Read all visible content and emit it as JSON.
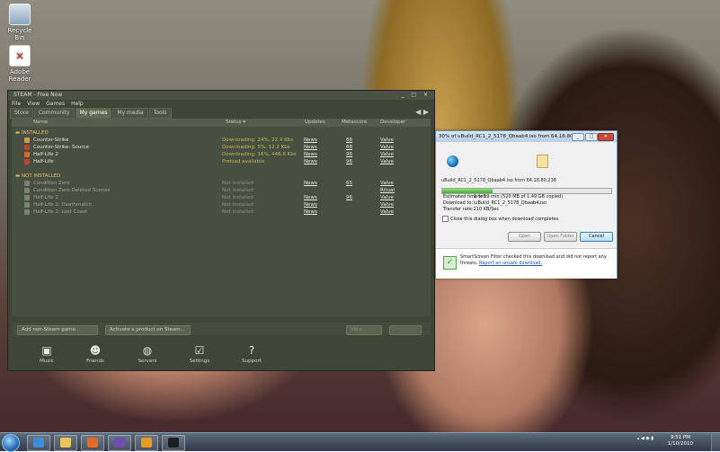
{
  "desktop": {
    "icons": [
      {
        "label": "Recycle Bin",
        "icon": "recycle-bin-icon"
      },
      {
        "label": "Adobe Reader",
        "icon": "pdf-icon"
      }
    ]
  },
  "steam": {
    "title": "STEAM - Free Now",
    "menu": [
      "File",
      "View",
      "Games",
      "Help"
    ],
    "tabs": [
      "Store",
      "Community",
      "My games",
      "My media",
      "Tools"
    ],
    "active_tab": "My games",
    "columns": [
      "Name",
      "Status ▾",
      "Updates",
      "Metascore",
      "Developer"
    ],
    "installed_heading": "▬ INSTALLED",
    "not_installed_heading": "▬ NOT INSTALLED",
    "installed": [
      {
        "name": "Counter-Strike",
        "status": "Downloading: 24%, 22.4 Kbs",
        "news": "News",
        "meta": "88",
        "dev": "Valve",
        "color": "#c9a04a"
      },
      {
        "name": "Counter-Strike: Source",
        "status": "Downloading: 5%, 12.2 Kbs",
        "news": "News",
        "meta": "88",
        "dev": "Valve",
        "color": "#b04c2c"
      },
      {
        "name": "Half-Life 2",
        "status": "Downloading: 16%, 446.6 Kbs",
        "news": "News",
        "meta": "96",
        "dev": "Valve",
        "color": "#d76b2e"
      },
      {
        "name": "Half-Life",
        "status": "Preload available",
        "news": "News",
        "meta": "96",
        "dev": "Valve",
        "color": "#c8442a"
      }
    ],
    "not_installed": [
      {
        "name": "Condition Zero",
        "status": "Not installed",
        "news": "News",
        "meta": "65",
        "dev": "Valve"
      },
      {
        "name": "Condition Zero Deleted Scenes",
        "status": "Not installed",
        "news": "",
        "meta": "",
        "dev": "Ritual"
      },
      {
        "name": "Half-Life 2",
        "status": "Not installed",
        "news": "News",
        "meta": "96",
        "dev": "Valve"
      },
      {
        "name": "Half-Life 2: Deathmatch",
        "status": "Not installed",
        "news": "News",
        "meta": "",
        "dev": "Valve"
      },
      {
        "name": "Half-Life 2: Lost Coast",
        "status": "Not installed",
        "news": "News",
        "meta": "",
        "dev": "Valve"
      }
    ],
    "add_game_button": "Add non-Steam game...",
    "activate_button": "Activate a product on Steam...",
    "view_button": "View",
    "dock": [
      {
        "label": "Music",
        "icon": "music-icon"
      },
      {
        "label": "Friends",
        "icon": "friends-icon"
      },
      {
        "label": "Servers",
        "icon": "globe-icon"
      },
      {
        "label": "Settings",
        "icon": "settings-icon"
      },
      {
        "label": "Support",
        "icon": "help-icon"
      }
    ]
  },
  "download_dialog": {
    "title": "30% of uBuild_RC1_2_5178_Qbaab4.iso from 64.18.80.238",
    "line1": "uBuild_RC1_2_5178_Qbaab4.iso from 64.18.80.238",
    "progress": 30,
    "estimated_label": "Estimated time left:",
    "estimated_value": "1 hr 19 min (520 MB of 1.49 GB copied)",
    "download_to_label": "Download to:",
    "download_to_value": "\\uBuild_RC1_2_5178_Qbaab4.iso",
    "transfer_label": "Transfer rate:",
    "transfer_value": "210 KB/Sec",
    "checkbox_label": "Close this dialog box when download completes",
    "buttons": [
      "Open",
      "Open Folder",
      "Cancel"
    ],
    "footer_text": "SmartScreen Filter checked this download and did not report any threats.",
    "footer_link": "Report an unsafe download."
  },
  "taskbar": {
    "time": "9:51 PM",
    "date": "1/10/2010",
    "apps": [
      {
        "icon": "ie-icon",
        "color": "#3a8fd6"
      },
      {
        "icon": "folder-icon",
        "color": "#e8c45a"
      },
      {
        "icon": "media-player-icon",
        "color": "#e26a28"
      },
      {
        "icon": "visual-studio-icon",
        "color": "#6d4fb0"
      },
      {
        "icon": "outlook-icon",
        "color": "#e59b24"
      },
      {
        "icon": "steam-icon",
        "color": "#1c1f22"
      }
    ]
  }
}
